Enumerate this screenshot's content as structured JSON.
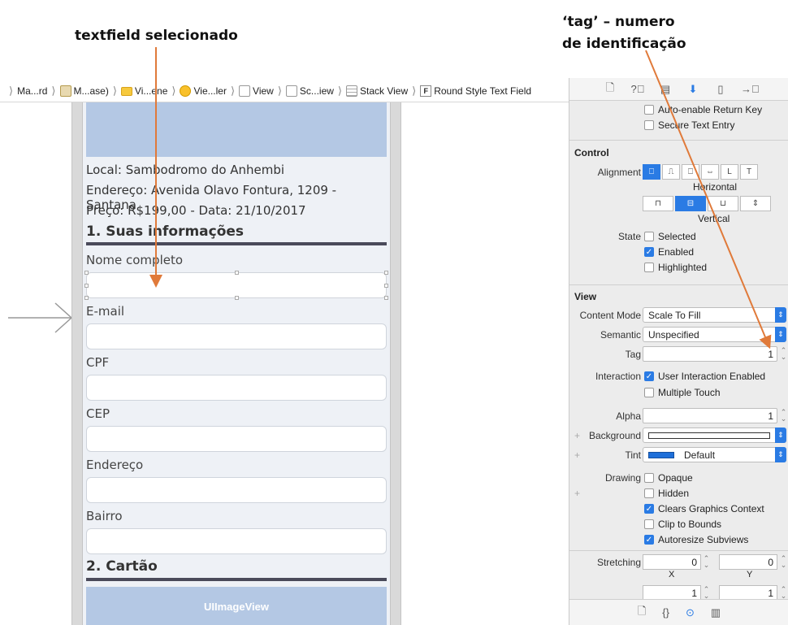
{
  "annotations": {
    "left": "textfield selecionado",
    "right_line1": "‘tag’ – numero",
    "right_line2": "de identificação"
  },
  "breadcrumb": [
    {
      "label": "Ma...rd",
      "icon": "file-icon"
    },
    {
      "label": "M...ase)",
      "icon": "storyboard-icon"
    },
    {
      "label": "Vi...ene",
      "icon": "folder-icon"
    },
    {
      "label": "Vie...ler",
      "icon": "view-controller-icon"
    },
    {
      "label": "View",
      "icon": "view-icon"
    },
    {
      "label": "Sc...iew",
      "icon": "view-icon"
    },
    {
      "label": "Stack View",
      "icon": "stack-view-icon"
    },
    {
      "label": "Round Style Text Field",
      "icon": "text-field-icon",
      "icon_letter": "F"
    }
  ],
  "phone": {
    "image_view_label": "UIImageView",
    "info": [
      "Local: Sambodromo do Anhembi",
      "Endereço: Avenida Olavo Fontura, 1209 - Santana",
      "Preço: R$199,00 - Data: 21/10/2017"
    ],
    "section1": "1. Suas informações",
    "section2": "2. Cartão",
    "fields": [
      "Nome completo",
      "E-mail",
      "CPF",
      "CEP",
      "Endereço",
      "Bairro"
    ]
  },
  "inspector": {
    "tabs": [
      "file-icon",
      "help-icon",
      "identity-icon",
      "attributes-icon",
      "size-icon",
      "connections-icon"
    ],
    "top_checks": [
      {
        "label": "Auto-enable Return Key",
        "checked": false
      },
      {
        "label": "Secure Text Entry",
        "checked": false
      }
    ],
    "control": {
      "header": "Control",
      "alignment_label": "Alignment",
      "horizontal_label": "Horizontal",
      "vertical_label": "Vertical",
      "state_label": "State",
      "states": [
        {
          "label": "Selected",
          "checked": false
        },
        {
          "label": "Enabled",
          "checked": true
        },
        {
          "label": "Highlighted",
          "checked": false
        }
      ]
    },
    "view": {
      "header": "View",
      "content_mode_label": "Content Mode",
      "content_mode_value": "Scale To Fill",
      "semantic_label": "Semantic",
      "semantic_value": "Unspecified",
      "tag_label": "Tag",
      "tag_value": "1",
      "interaction_label": "Interaction",
      "interaction": [
        {
          "label": "User Interaction Enabled",
          "checked": true
        },
        {
          "label": "Multiple Touch",
          "checked": false
        }
      ],
      "alpha_label": "Alpha",
      "alpha_value": "1",
      "background_label": "Background",
      "tint_label": "Tint",
      "tint_value": "Default",
      "tint_color": "#1e6fd9",
      "drawing_label": "Drawing",
      "drawing": [
        {
          "label": "Opaque",
          "checked": false
        },
        {
          "label": "Hidden",
          "checked": false
        },
        {
          "label": "Clears Graphics Context",
          "checked": true
        },
        {
          "label": "Clip to Bounds",
          "checked": false
        },
        {
          "label": "Autoresize Subviews",
          "checked": true
        }
      ],
      "stretching_label": "Stretching",
      "stretch_x": "0",
      "stretch_y": "0",
      "x_label": "X",
      "y_label": "Y",
      "stretch_w": "1",
      "stretch_h": "1"
    }
  },
  "colors": {
    "accent": "#2a7be4",
    "annotation_arrow": "#e07a3a",
    "image_view": "#b4c8e4"
  }
}
